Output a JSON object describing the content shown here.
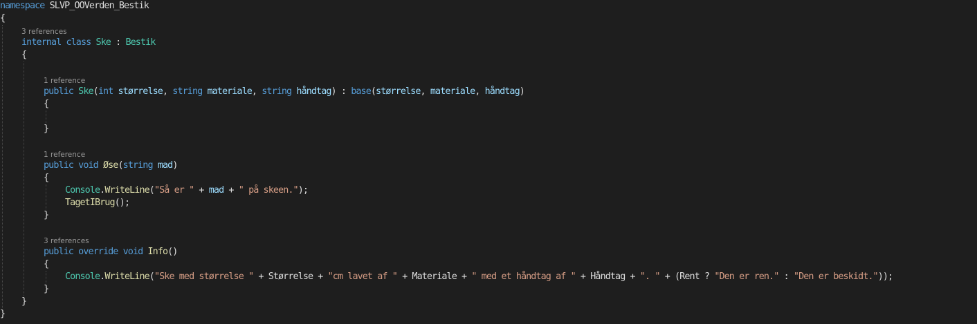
{
  "colors": {
    "background": "#1e1e1e",
    "plain": "#dcdcdc",
    "keyword": "#569cd6",
    "type": "#4ec9b0",
    "method": "#dcdcaa",
    "parameter": "#9cdcfe",
    "string": "#d69d85",
    "codelens": "#999999",
    "guide": "#4a4a4a"
  },
  "editor": {
    "code_lines": [
      {
        "indent": 0,
        "tokens": [
          {
            "t": "namespace",
            "k": "keyword"
          },
          {
            "t": " SLVP_OOVerden_Bestik",
            "k": "plain"
          }
        ]
      },
      {
        "indent": 0,
        "tokens": [
          {
            "t": "{",
            "k": "plain"
          }
        ]
      },
      {
        "indent": 1,
        "codelens": "3 references",
        "tokens": [
          {
            "t": "internal",
            "k": "keyword"
          },
          {
            "t": " ",
            "k": "plain"
          },
          {
            "t": "class",
            "k": "keyword"
          },
          {
            "t": " ",
            "k": "plain"
          },
          {
            "t": "Ske",
            "k": "type"
          },
          {
            "t": " : ",
            "k": "plain"
          },
          {
            "t": "Bestik",
            "k": "type"
          }
        ]
      },
      {
        "indent": 1,
        "tokens": [
          {
            "t": "{",
            "k": "plain"
          }
        ]
      },
      {
        "indent": 0,
        "tokens": []
      },
      {
        "indent": 2,
        "codelens": "1 reference",
        "tokens": [
          {
            "t": "public",
            "k": "keyword"
          },
          {
            "t": " ",
            "k": "plain"
          },
          {
            "t": "Ske",
            "k": "type"
          },
          {
            "t": "(",
            "k": "plain"
          },
          {
            "t": "int",
            "k": "keyword"
          },
          {
            "t": " ",
            "k": "plain"
          },
          {
            "t": "størrelse",
            "k": "parameter"
          },
          {
            "t": ", ",
            "k": "plain"
          },
          {
            "t": "string",
            "k": "keyword"
          },
          {
            "t": " ",
            "k": "plain"
          },
          {
            "t": "materiale",
            "k": "parameter"
          },
          {
            "t": ", ",
            "k": "plain"
          },
          {
            "t": "string",
            "k": "keyword"
          },
          {
            "t": " ",
            "k": "plain"
          },
          {
            "t": "håndtag",
            "k": "parameter"
          },
          {
            "t": ") : ",
            "k": "plain"
          },
          {
            "t": "base",
            "k": "keyword"
          },
          {
            "t": "(",
            "k": "plain"
          },
          {
            "t": "størrelse",
            "k": "parameter"
          },
          {
            "t": ", ",
            "k": "plain"
          },
          {
            "t": "materiale",
            "k": "parameter"
          },
          {
            "t": ", ",
            "k": "plain"
          },
          {
            "t": "håndtag",
            "k": "parameter"
          },
          {
            "t": ")",
            "k": "plain"
          }
        ]
      },
      {
        "indent": 2,
        "tokens": [
          {
            "t": "{",
            "k": "plain"
          }
        ]
      },
      {
        "indent": 0,
        "tokens": []
      },
      {
        "indent": 2,
        "tokens": [
          {
            "t": "}",
            "k": "plain"
          }
        ]
      },
      {
        "indent": 0,
        "tokens": []
      },
      {
        "indent": 2,
        "codelens": "1 reference",
        "tokens": [
          {
            "t": "public",
            "k": "keyword"
          },
          {
            "t": " ",
            "k": "plain"
          },
          {
            "t": "void",
            "k": "keyword"
          },
          {
            "t": " ",
            "k": "plain"
          },
          {
            "t": "Øse",
            "k": "method"
          },
          {
            "t": "(",
            "k": "plain"
          },
          {
            "t": "string",
            "k": "keyword"
          },
          {
            "t": " ",
            "k": "plain"
          },
          {
            "t": "mad",
            "k": "parameter"
          },
          {
            "t": ")",
            "k": "plain"
          }
        ]
      },
      {
        "indent": 2,
        "tokens": [
          {
            "t": "{",
            "k": "plain"
          }
        ]
      },
      {
        "indent": 3,
        "tokens": [
          {
            "t": "Console",
            "k": "type"
          },
          {
            "t": ".",
            "k": "plain"
          },
          {
            "t": "WriteLine",
            "k": "method"
          },
          {
            "t": "(",
            "k": "plain"
          },
          {
            "t": "\"Så er \"",
            "k": "string"
          },
          {
            "t": " + ",
            "k": "plain"
          },
          {
            "t": "mad",
            "k": "parameter"
          },
          {
            "t": " + ",
            "k": "plain"
          },
          {
            "t": "\" på skeen.\"",
            "k": "string"
          },
          {
            "t": ");",
            "k": "plain"
          }
        ]
      },
      {
        "indent": 3,
        "tokens": [
          {
            "t": "TagetIBrug",
            "k": "method"
          },
          {
            "t": "();",
            "k": "plain"
          }
        ]
      },
      {
        "indent": 2,
        "tokens": [
          {
            "t": "}",
            "k": "plain"
          }
        ]
      },
      {
        "indent": 0,
        "tokens": []
      },
      {
        "indent": 2,
        "codelens": "3 references",
        "tokens": [
          {
            "t": "public",
            "k": "keyword"
          },
          {
            "t": " ",
            "k": "plain"
          },
          {
            "t": "override",
            "k": "keyword"
          },
          {
            "t": " ",
            "k": "plain"
          },
          {
            "t": "void",
            "k": "keyword"
          },
          {
            "t": " ",
            "k": "plain"
          },
          {
            "t": "Info",
            "k": "method"
          },
          {
            "t": "()",
            "k": "plain"
          }
        ]
      },
      {
        "indent": 2,
        "tokens": [
          {
            "t": "{",
            "k": "plain"
          }
        ]
      },
      {
        "indent": 3,
        "tokens": [
          {
            "t": "Console",
            "k": "type"
          },
          {
            "t": ".",
            "k": "plain"
          },
          {
            "t": "WriteLine",
            "k": "method"
          },
          {
            "t": "(",
            "k": "plain"
          },
          {
            "t": "\"Ske med størrelse \"",
            "k": "string"
          },
          {
            "t": " + Størrelse + ",
            "k": "plain"
          },
          {
            "t": "\"cm lavet af \"",
            "k": "string"
          },
          {
            "t": " + Materiale + ",
            "k": "plain"
          },
          {
            "t": "\" med et håndtag af \"",
            "k": "string"
          },
          {
            "t": " + Håndtag + ",
            "k": "plain"
          },
          {
            "t": "\". \"",
            "k": "string"
          },
          {
            "t": " + (Rent ? ",
            "k": "plain"
          },
          {
            "t": "\"Den er ren.\"",
            "k": "string"
          },
          {
            "t": " : ",
            "k": "plain"
          },
          {
            "t": "\"Den er beskidt.\"",
            "k": "string"
          },
          {
            "t": "));",
            "k": "plain"
          }
        ]
      },
      {
        "indent": 2,
        "tokens": [
          {
            "t": "}",
            "k": "plain"
          }
        ]
      },
      {
        "indent": 1,
        "tokens": [
          {
            "t": "}",
            "k": "plain"
          }
        ]
      },
      {
        "indent": 0,
        "tokens": [
          {
            "t": "}",
            "k": "plain"
          }
        ]
      }
    ]
  }
}
